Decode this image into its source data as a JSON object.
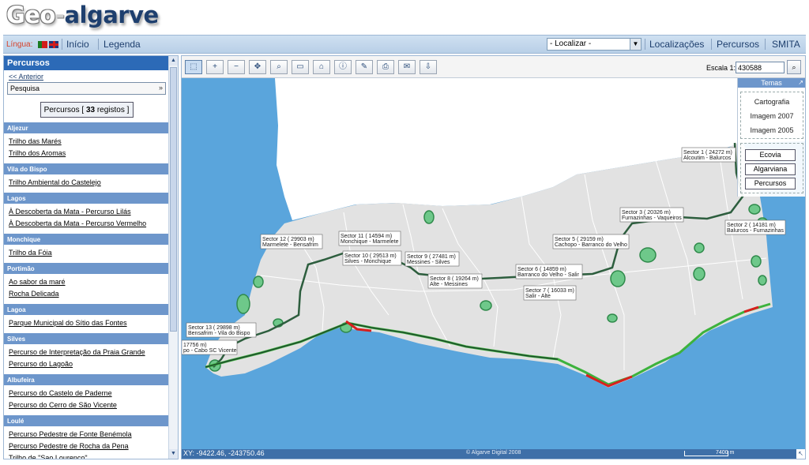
{
  "logo": {
    "geo": "Geo",
    "sep": "-",
    "algarve": "algarve"
  },
  "topbar": {
    "lang_label": "Língua:",
    "home": "Início",
    "legend": "Legenda",
    "locate_value": "- Localizar -",
    "locations": "Localizações",
    "routes": "Percursos",
    "smita": "SMITA"
  },
  "sidebar": {
    "title": "Percursos",
    "back": "<< Anterior",
    "search_value": "Pesquisa",
    "count_prefix": "Percursos [ ",
    "count": "33",
    "count_suffix": " registos ]",
    "groups": [
      {
        "name": "Aljezur",
        "items": [
          "Trilho das Marés",
          "Trilho dos Aromas"
        ]
      },
      {
        "name": "Vila do Bispo",
        "items": [
          "Trilho Ambiental do Castelejo"
        ]
      },
      {
        "name": "Lagos",
        "items": [
          "À Descoberta da Mata - Percurso Lilás",
          "À Descoberta da Mata - Percurso Vermelho"
        ]
      },
      {
        "name": "Monchique",
        "items": [
          "Trilho da Fóia"
        ]
      },
      {
        "name": "Portimão",
        "items": [
          "Ao sabor da maré",
          "Rocha Delicada"
        ]
      },
      {
        "name": "Lagoa",
        "items": [
          "Parque Municipal do Sítio das Fontes"
        ]
      },
      {
        "name": "Silves",
        "items": [
          "Percurso de Interpretação da Praia Grande",
          "Percurso do Lagoão"
        ]
      },
      {
        "name": "Albufeira",
        "items": [
          "Percurso do Castelo de Paderne",
          "Percurso do Cerro de São Vicente"
        ]
      },
      {
        "name": "Loulé",
        "items": [
          "Percurso Pedestre de Fonte Benémola",
          "Percurso Pedestre de Rocha da Pena",
          "Trilho de \"Sao Lourenco\""
        ]
      }
    ]
  },
  "toolbar": {
    "tools": [
      "select-tool-icon",
      "zoom-in-icon",
      "zoom-out-icon",
      "pan-icon",
      "zoom-area-icon",
      "measure-icon",
      "home-view-icon",
      "info-icon",
      "edit-icon",
      "print-icon",
      "email-icon",
      "export-icon"
    ],
    "scale_label": "Escala 1:",
    "scale_value": "430588"
  },
  "themes": {
    "title": "Temas",
    "base": [
      "Cartografia",
      "Imagem 2007",
      "Imagem 2005"
    ],
    "overlays": [
      "Ecovia",
      "Algarviana",
      "Percursos"
    ]
  },
  "map_labels": [
    {
      "l1": "Sector 1 ( 24272 m)",
      "l2": "Alcoutim - Balurcos"
    },
    {
      "l1": "Sector 2 ( 14181 m)",
      "l2": "Balurcos - Furnazinhas"
    },
    {
      "l1": "Sector 3 ( 20326 m)",
      "l2": "Furnazinhas - Vaqueiros"
    },
    {
      "l1": "Sector 5 ( 29159 m)",
      "l2": "Cachopo - Barranco do Velho"
    },
    {
      "l1": "Sector 6 ( 14859 m)",
      "l2": "Barranco do Velho - Salir"
    },
    {
      "l1": "Sector 7 ( 16033 m)",
      "l2": "Salir - Alte"
    },
    {
      "l1": "Sector 8 ( 19264 m)",
      "l2": "Alte - Messines"
    },
    {
      "l1": "Sector 9 ( 27481 m)",
      "l2": "Messines - Silves"
    },
    {
      "l1": "Sector 10 ( 29513 m)",
      "l2": "Silves - Monchique"
    },
    {
      "l1": "Sector 11 ( 14594 m)",
      "l2": "Monchique - Marmelete"
    },
    {
      "l1": "Sector 12 ( 29903 m)",
      "l2": "Marmelete - Bensafrim"
    },
    {
      "l1": "Sector 13 ( 29898 m)",
      "l2": "Bensafrim - Vila do Bispo"
    },
    {
      "l1": "17756 m)",
      "l2": "po - Cabo SC Vicente"
    }
  ],
  "status": {
    "coords": "XY: -9422.46, -243750.46",
    "copyright": "© Algarve Digital 2008",
    "scale_bar": "7400 m"
  },
  "colors": {
    "sea": "#5aa5dc",
    "land": "#e2e2e2",
    "topbar": "#c4d7ec",
    "section_header": "#6d96cb",
    "route_dark": "#2d5e3e",
    "route_green": "#3db23d",
    "route_red": "#d8201e"
  }
}
